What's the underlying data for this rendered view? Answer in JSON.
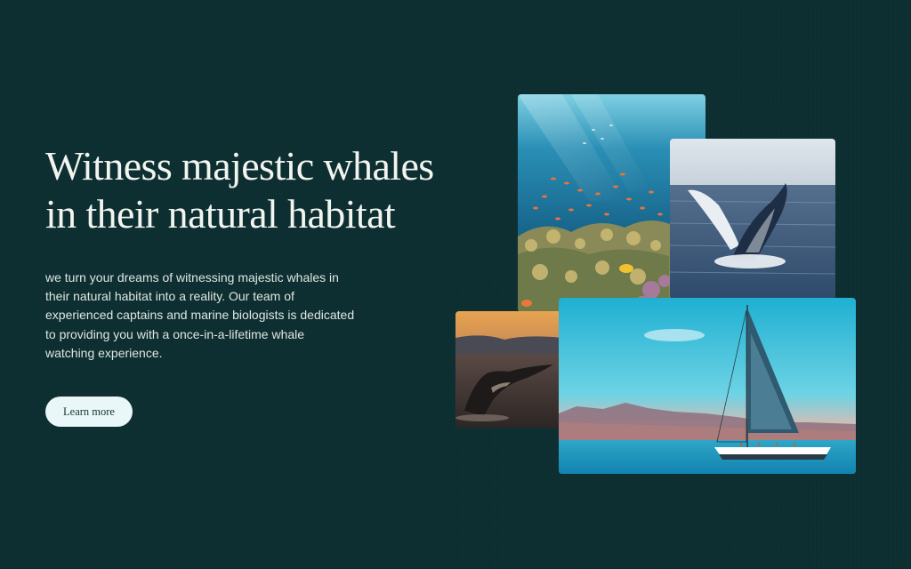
{
  "hero": {
    "title_lines": [
      "Witness majestic whales",
      "in their natural habitat"
    ],
    "body_lines": [
      "we turn your dreams of witnessing majestic whales in",
      "their natural habitat into a reality. Our team of",
      "experienced captains and marine biologists is dedicated",
      "to providing you with a once-in-a-lifetime whale",
      "watching experience."
    ],
    "cta_label": "Learn more"
  },
  "gallery": {
    "images": [
      {
        "subject": "coral-reef-photo"
      },
      {
        "subject": "whale-breach-photo"
      },
      {
        "subject": "whale-tail-photo"
      },
      {
        "subject": "sailboat-photo"
      }
    ]
  },
  "colors": {
    "background": "#0c2e30",
    "title": "#f2f5ef",
    "body": "#dfe6e2",
    "button_bg": "#e9f7f8",
    "button_text": "#123536"
  }
}
